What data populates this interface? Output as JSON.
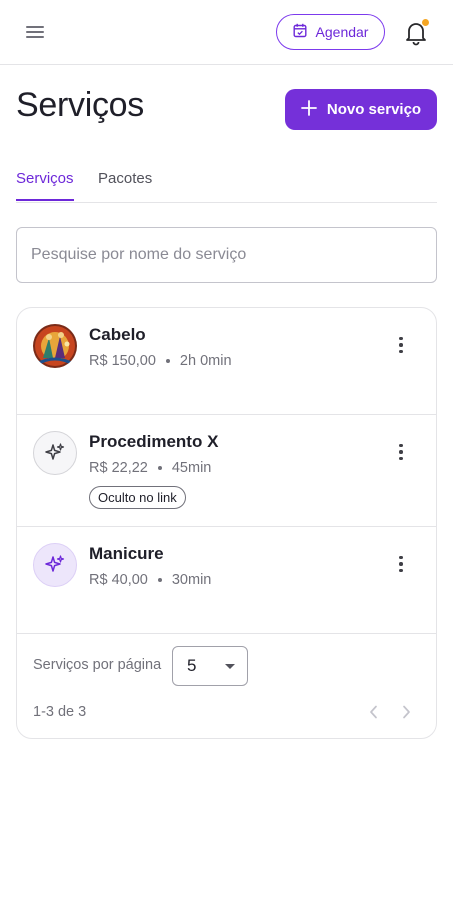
{
  "header": {
    "menu_icon": "hamburger-menu-icon",
    "schedule_button": {
      "label": "Agendar",
      "icon": "calendar-icon"
    },
    "notifications_icon": "bell-icon",
    "notification_dot_color": "#f5a623"
  },
  "page": {
    "title": "Serviços",
    "new_service_button": {
      "label": "Novo serviço",
      "icon": "plus-icon"
    }
  },
  "tabs": [
    {
      "label": "Serviços",
      "active": true
    },
    {
      "label": "Pacotes",
      "active": false
    }
  ],
  "search": {
    "placeholder": "Pesquise por nome do serviço",
    "value": ""
  },
  "services": [
    {
      "name": "Cabelo",
      "price": "R$ 150,00",
      "duration": "2h 0min",
      "avatar": "photo",
      "badge": ""
    },
    {
      "name": "Procedimento X",
      "price": "R$ 22,22",
      "duration": "45min",
      "avatar": "sparkles-icon",
      "badge": "Oculto no link"
    },
    {
      "name": "Manicure",
      "price": "R$ 40,00",
      "duration": "30min",
      "avatar": "sparkles-icon",
      "badge": ""
    }
  ],
  "pagination": {
    "per_page_label": "Serviços por página",
    "per_page_value": "5",
    "range_label": "1-3 de 3",
    "prev_icon": "chevron-left-icon",
    "next_icon": "chevron-right-icon"
  },
  "colors": {
    "primary": "#7530d9",
    "primary_text": "#6d28d9",
    "muted_text": "#71717a",
    "border": "#e4e4e7"
  }
}
